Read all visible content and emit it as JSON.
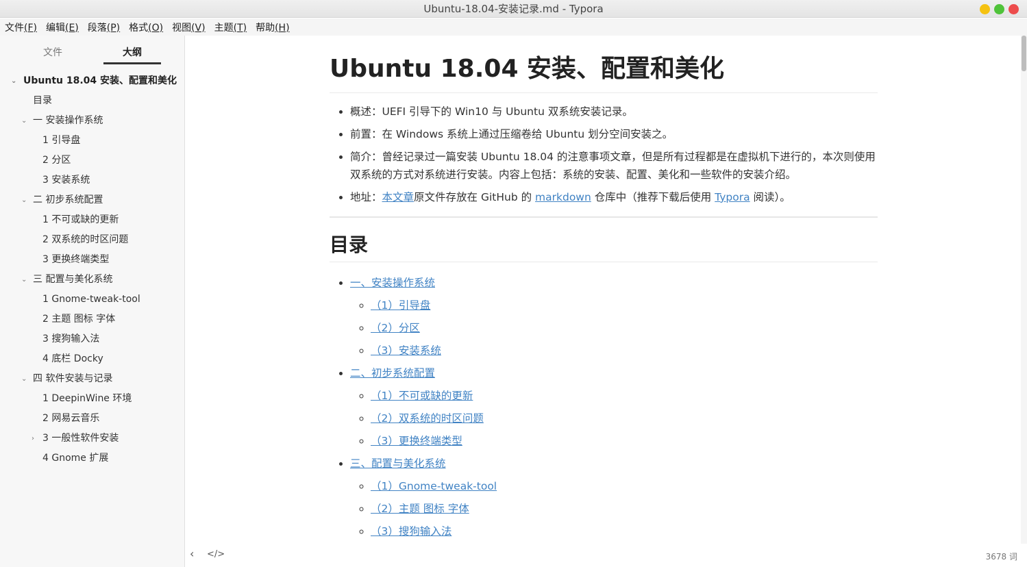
{
  "window": {
    "title": "Ubuntu-18.04-安装记录.md - Typora",
    "colors": {
      "minimize": "#f5c211",
      "maximize": "#4fc33a",
      "close": "#ed4c4c"
    }
  },
  "menu": [
    {
      "label": "文件",
      "key": "(F)"
    },
    {
      "label": "编辑",
      "key": "(E)"
    },
    {
      "label": "段落",
      "key": "(P)"
    },
    {
      "label": "格式",
      "key": "(O)"
    },
    {
      "label": "视图",
      "key": "(V)"
    },
    {
      "label": "主题",
      "key": "(T)"
    },
    {
      "label": "帮助",
      "key": "(H)"
    }
  ],
  "sidebar": {
    "tab_files": "文件",
    "tab_outline": "大纲",
    "outline": [
      {
        "level": 1,
        "label": "Ubuntu 18.04 安装、配置和美化",
        "arrow": "⌄"
      },
      {
        "level": 2,
        "label": "目录",
        "arrow": ""
      },
      {
        "level": 2,
        "label": "一 安装操作系统",
        "arrow": "⌄"
      },
      {
        "level": 3,
        "label": "1 引导盘",
        "arrow": ""
      },
      {
        "level": 3,
        "label": "2 分区",
        "arrow": ""
      },
      {
        "level": 3,
        "label": "3 安装系统",
        "arrow": ""
      },
      {
        "level": 2,
        "label": "二 初步系统配置",
        "arrow": "⌄"
      },
      {
        "level": 3,
        "label": "1 不可或缺的更新",
        "arrow": ""
      },
      {
        "level": 3,
        "label": "2 双系统的时区问题",
        "arrow": ""
      },
      {
        "level": 3,
        "label": "3 更换终端类型",
        "arrow": ""
      },
      {
        "level": 2,
        "label": "三 配置与美化系统",
        "arrow": "⌄"
      },
      {
        "level": 3,
        "label": "1 Gnome-tweak-tool",
        "arrow": ""
      },
      {
        "level": 3,
        "label": "2 主题 图标 字体",
        "arrow": ""
      },
      {
        "level": 3,
        "label": "3 搜狗输入法",
        "arrow": ""
      },
      {
        "level": 3,
        "label": "4 底栏 Docky",
        "arrow": ""
      },
      {
        "level": 2,
        "label": "四 软件安装与记录",
        "arrow": "⌄"
      },
      {
        "level": 3,
        "label": "1 DeepinWine 环境",
        "arrow": ""
      },
      {
        "level": 3,
        "label": "2 网易云音乐",
        "arrow": ""
      },
      {
        "level": 3,
        "label": "3 一般性软件安装",
        "arrow": "›"
      },
      {
        "level": 3,
        "label": "4 Gnome 扩展",
        "arrow": ""
      }
    ]
  },
  "document": {
    "title": "Ubuntu 18.04 安装、配置和美化",
    "intro": {
      "overview": "概述：UEFI 引导下的 Win10 与 Ubuntu 双系统安装记录。",
      "prereq": "前置：在 Windows 系统上通过压缩卷给 Ubuntu 划分空间安装之。",
      "summary": "简介：曾经记录过一篇安装 Ubuntu 18.04 的注意事项文章，但是所有过程都是在虚拟机下进行的，本次则使用双系统的方式对系统进行安装。内容上包括：系统的安装、配置、美化和一些软件的安装介绍。",
      "address_prefix": "地址：",
      "address_link1": "本文章",
      "address_mid1": "原文件存放在 GitHub 的 ",
      "address_link2": "markdown",
      "address_mid2": " 仓库中（推荐下载后使用 ",
      "address_link3": "Typora",
      "address_suffix": " 阅读）。"
    },
    "toc_heading": "目录",
    "toc": [
      {
        "label": "一、安装操作系统",
        "children": [
          "（1）引导盘",
          "（2）分区",
          "（3）安装系统"
        ]
      },
      {
        "label": "二、初步系统配置",
        "children": [
          "（1）不可或缺的更新",
          "（2）双系统的时区问题",
          "（3）更换终端类型"
        ]
      },
      {
        "label": "三、配置与美化系统",
        "children": [
          "（1）Gnome-tweak-tool",
          "（2）主题 图标 字体",
          "（3）搜狗输入法"
        ]
      }
    ]
  },
  "footer": {
    "back_icon": "‹",
    "source_icon": "</>",
    "word_count": "3678 词"
  }
}
